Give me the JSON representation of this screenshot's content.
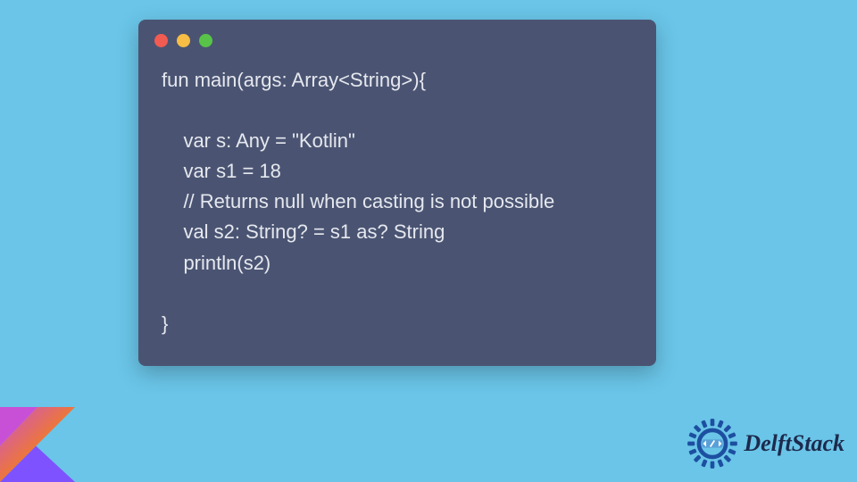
{
  "window": {
    "dots": [
      "red",
      "yellow",
      "green"
    ]
  },
  "code": {
    "lines": [
      "fun main(args: Array<String>){",
      "",
      "    var s: Any = \"Kotlin\"",
      "    var s1 = 18",
      "    // Returns null when casting is not possible",
      "    val s2: String? = s1 as? String",
      "    println(s2)",
      "",
      "}"
    ]
  },
  "branding": {
    "name": "DelftStack",
    "kotlin_colors": {
      "top": "#c850d7",
      "mid": "#f07a2b",
      "bot": "#7f52ff"
    },
    "gear_color": "#1d4fa1",
    "tag_bg": "#5aa0d8"
  }
}
